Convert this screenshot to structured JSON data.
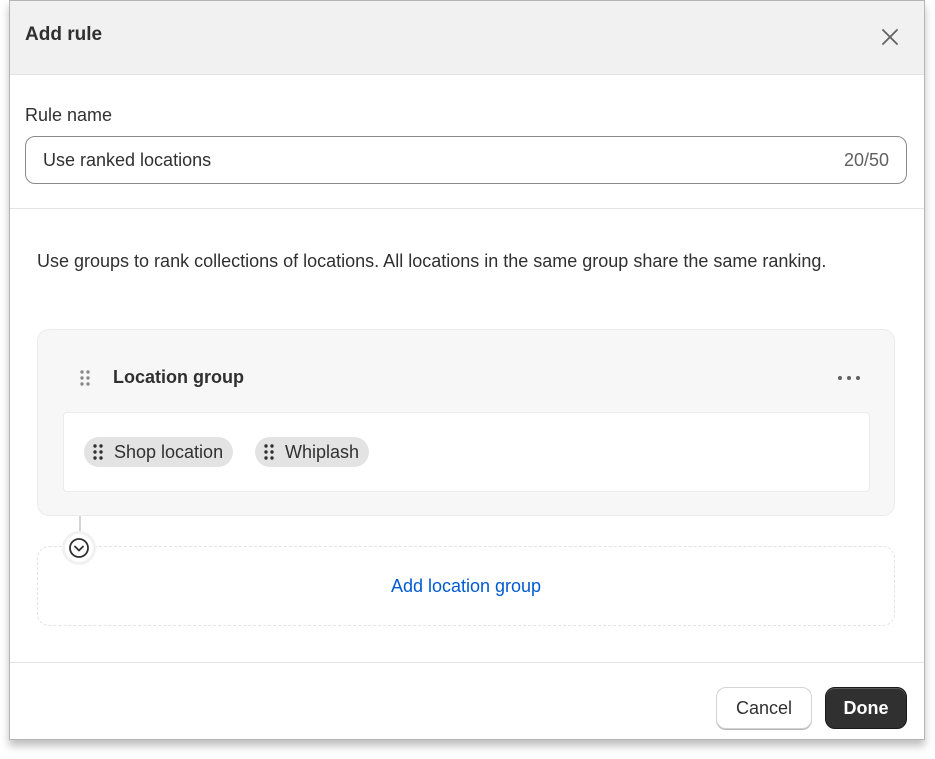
{
  "modal": {
    "title": "Add rule",
    "close_icon": "close-icon"
  },
  "rule_name": {
    "label": "Rule name",
    "value": "Use ranked locations",
    "char_count": "20/50"
  },
  "description": "Use groups to rank collections of locations. All locations in the same group share the same ranking.",
  "location_group": {
    "title": "Location group",
    "menu_icon": "more-horizontal-icon",
    "drag_icon": "drag-handle-icon",
    "locations": [
      {
        "label": "Shop location"
      },
      {
        "label": "Whiplash"
      }
    ]
  },
  "connector": {
    "icon": "chevron-down-circle-icon"
  },
  "add_group": {
    "label": "Add location group"
  },
  "footer": {
    "cancel_label": "Cancel",
    "done_label": "Done"
  },
  "colors": {
    "link": "#005bd3",
    "primary_button": "#303030",
    "header_bg": "#f1f1f1",
    "card_bg": "#f7f7f7"
  }
}
